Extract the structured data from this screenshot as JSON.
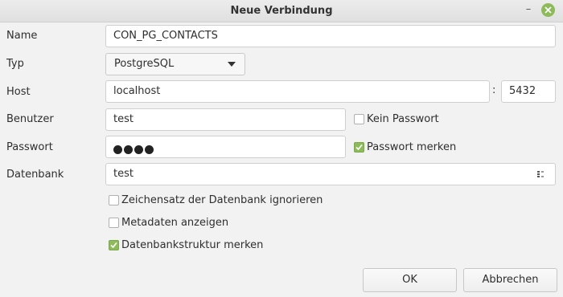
{
  "window": {
    "title": "Neue Verbindung",
    "minimize_glyph": "–"
  },
  "labels": {
    "name": "Name",
    "type": "Typ",
    "host": "Host",
    "user": "Benutzer",
    "password": "Passwort",
    "database": "Datenbank"
  },
  "fields": {
    "name": "CON_PG_CONTACTS",
    "type_selected": "PostgreSQL",
    "host": "localhost",
    "port": "5432",
    "user": "test",
    "password_mask_count": 4,
    "database": "test"
  },
  "host_port_separator": ":",
  "checks": {
    "no_password": {
      "label": "Kein Passwort",
      "checked": false
    },
    "remember_password": {
      "label": "Passwort merken",
      "checked": true
    },
    "ignore_charset": {
      "label": "Zeichensatz der Datenbank ignorieren",
      "checked": false
    },
    "show_metadata": {
      "label": "Metadaten anzeigen",
      "checked": false
    },
    "remember_db_structure": {
      "label": "Datenbankstruktur merken",
      "checked": true
    }
  },
  "buttons": {
    "ok": "OK",
    "cancel": "Abbrechen"
  },
  "colors": {
    "accent": "#8dbb5a",
    "background": "#f2f2f2"
  },
  "icons": {
    "close": "close-icon",
    "minimize": "minimize-icon",
    "dropdown": "chevron-down-icon",
    "database_picker": "database-picker-icon"
  }
}
